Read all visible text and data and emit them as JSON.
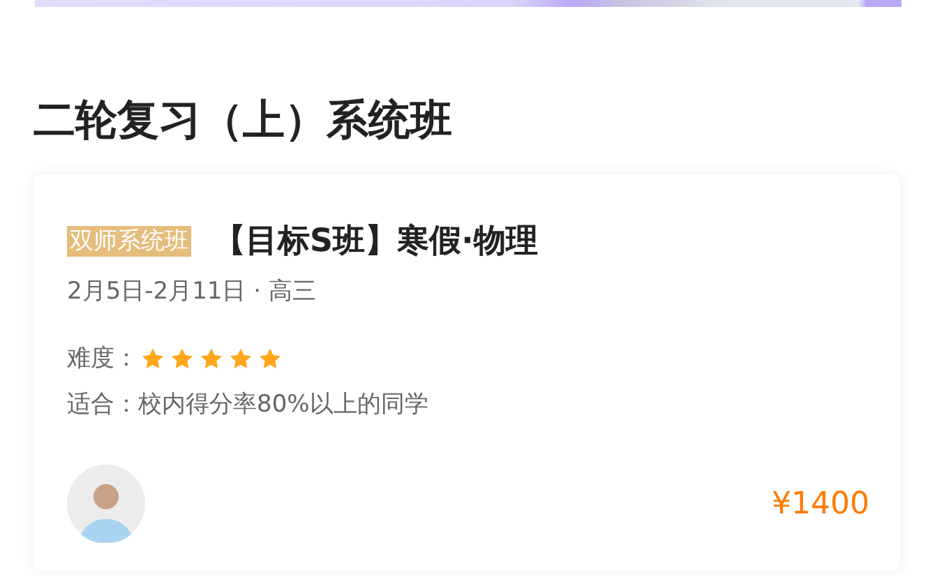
{
  "section_title": "二轮复习（上）系统班",
  "course": {
    "tag": "双师系统班",
    "title": "【目标S班】寒假·物理",
    "schedule": "2月5日-2月11日 · 高三",
    "difficulty": {
      "label": "难度：",
      "stars": 5
    },
    "suitable": "适合：校内得分率80%以上的同学",
    "price": "¥1400"
  }
}
